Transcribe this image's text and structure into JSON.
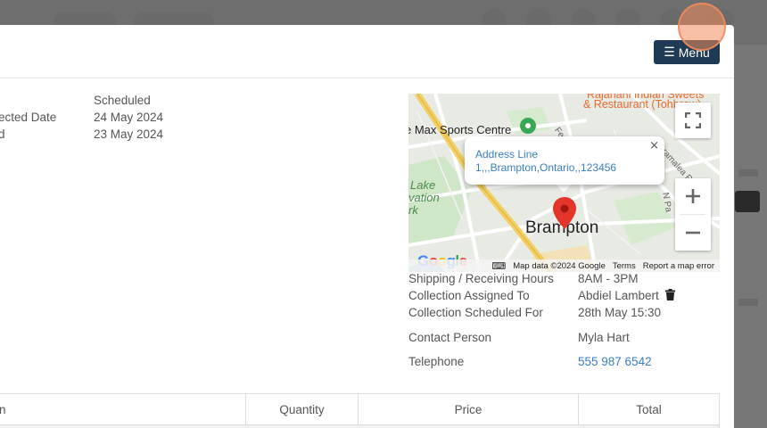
{
  "header": {
    "menu_label": "Menu"
  },
  "details": {
    "status_value": "Scheduled",
    "expected_date_label": "ected Date",
    "expected_date_value": "24 May 2024",
    "date_label": "d",
    "date_value": "23 May 2024"
  },
  "map": {
    "popup_address": "Address Line 1,,,Brampton,Ontario,,123456",
    "close_glyph": "×",
    "city_label": "Brampton",
    "poi_sports": "e Max Sports Centre",
    "poi_restaurant_1": "Rajanani Indian Sweets",
    "poi_restaurant_2": "& Restaurant (Tohbrow)",
    "park_label_1": "Lake",
    "park_label_2": "vation",
    "park_label_3": "rk",
    "street_fernforest": "Fernforest D",
    "street_bramalea": "Bramalea Rd",
    "street_np": "N Pa",
    "google_logo": "Google",
    "footer_map_data": "Map data ©2024 Google",
    "footer_terms": "Terms",
    "footer_report": "Report a map error"
  },
  "info": {
    "hours_label": "Shipping / Receiving Hours",
    "hours_value": "8AM - 3PM",
    "assigned_label": "Collection Assigned To",
    "assigned_value": "Abdiel Lambert",
    "scheduled_label": "Collection Scheduled For",
    "scheduled_value": "28th May 15:30",
    "contact_label": "Contact Person",
    "contact_value": "Myla Hart",
    "phone_label": "Telephone",
    "phone_value": "555 987 6542"
  },
  "table": {
    "col_item": "n",
    "col_quantity": "Quantity",
    "col_price": "Price",
    "col_total": "Total"
  },
  "colors": {
    "menu_button": "#1e3a54",
    "link": "#3a7fc4",
    "highlight": "#f08c5a"
  }
}
